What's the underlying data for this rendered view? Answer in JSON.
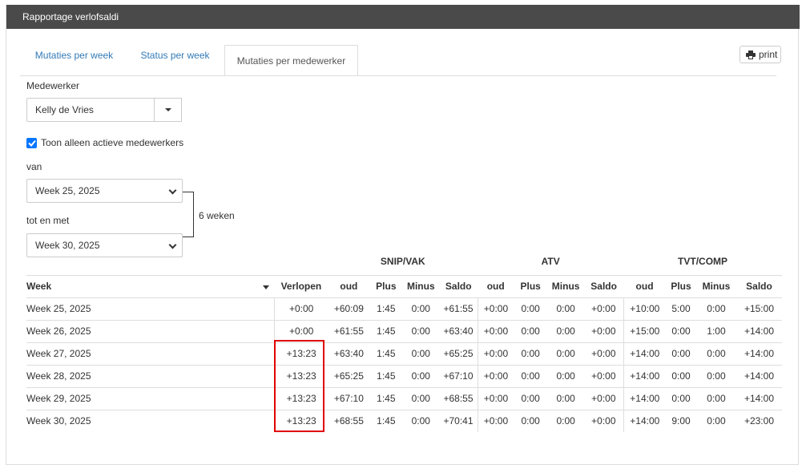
{
  "panel": {
    "title": "Rapportage verlofsaldi"
  },
  "tabs": [
    {
      "label": "Mutaties per week",
      "active": false
    },
    {
      "label": "Status per week",
      "active": false
    },
    {
      "label": "Mutaties per medewerker",
      "active": true
    }
  ],
  "print": {
    "label": "print",
    "icon": "printer-icon"
  },
  "filters": {
    "employee_label": "Medewerker",
    "employee_value": "Kelly de Vries",
    "active_only_label": "Toon alleen actieve medewerkers",
    "active_only_checked": true,
    "from_label": "van",
    "from_value": "Week 25, 2025",
    "to_label": "tot en met",
    "to_value": "Week 30, 2025",
    "duration_text": "6 weken"
  },
  "table": {
    "groups": [
      "SNIP/VAK",
      "ATV",
      "TVT/COMP"
    ],
    "headers": [
      "Week",
      "Verlopen",
      "oud",
      "Plus",
      "Minus",
      "Saldo",
      "oud",
      "Plus",
      "Minus",
      "Saldo",
      "oud",
      "Plus",
      "Minus",
      "Saldo"
    ],
    "rows": [
      [
        "Week 25, 2025",
        "+0:00",
        "+60:09",
        "1:45",
        "0:00",
        "+61:55",
        "+0:00",
        "0:00",
        "0:00",
        "+0:00",
        "+10:00",
        "5:00",
        "0:00",
        "+15:00"
      ],
      [
        "Week 26, 2025",
        "+0:00",
        "+61:55",
        "1:45",
        "0:00",
        "+63:40",
        "+0:00",
        "0:00",
        "0:00",
        "+0:00",
        "+15:00",
        "0:00",
        "1:00",
        "+14:00"
      ],
      [
        "Week 27, 2025",
        "+13:23",
        "+63:40",
        "1:45",
        "0:00",
        "+65:25",
        "+0:00",
        "0:00",
        "0:00",
        "+0:00",
        "+14:00",
        "0:00",
        "0:00",
        "+14:00"
      ],
      [
        "Week 28, 2025",
        "+13:23",
        "+65:25",
        "1:45",
        "0:00",
        "+67:10",
        "+0:00",
        "0:00",
        "0:00",
        "+0:00",
        "+14:00",
        "0:00",
        "0:00",
        "+14:00"
      ],
      [
        "Week 29, 2025",
        "+13:23",
        "+67:10",
        "1:45",
        "0:00",
        "+68:55",
        "+0:00",
        "0:00",
        "0:00",
        "+0:00",
        "+14:00",
        "0:00",
        "0:00",
        "+14:00"
      ],
      [
        "Week 30, 2025",
        "+13:23",
        "+68:55",
        "1:45",
        "0:00",
        "+70:41",
        "+0:00",
        "0:00",
        "0:00",
        "+0:00",
        "+14:00",
        "9:00",
        "0:00",
        "+23:00"
      ]
    ]
  },
  "colors": {
    "header_bg": "#4a4a4a",
    "link": "#337ab7",
    "checkbox": "#0075ff",
    "highlight": "#e00000"
  }
}
